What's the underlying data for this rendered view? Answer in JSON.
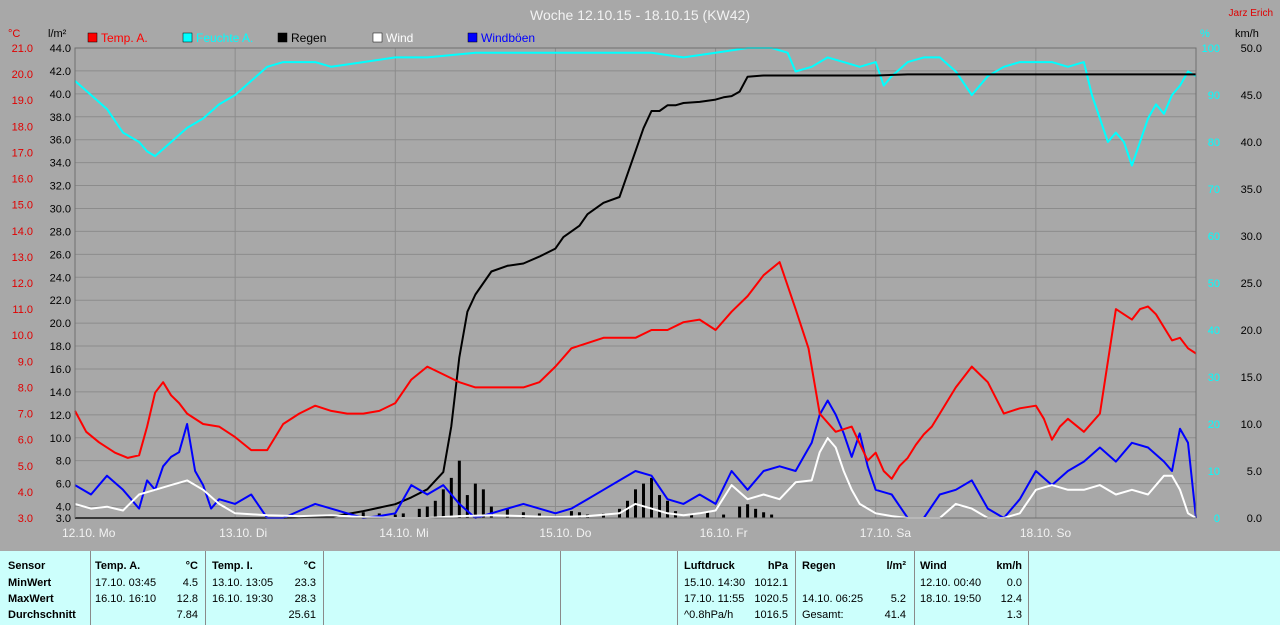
{
  "chart_data": {
    "type": "line",
    "title": "Woche 12.10.15 - 18.10.15 (KW42)",
    "author": "Jarz Erich",
    "x_start": "12.10. 00:00",
    "x_end": "18.10. 23:59",
    "x_tick_labels": [
      "12.10. Mo",
      "13.10. Di",
      "14.10. Mi",
      "15.10. Do",
      "16.10. Fr",
      "17.10. Sa",
      "18.10. So"
    ],
    "axes": {
      "temp": {
        "unit": "°C",
        "min": 3.0,
        "max": 21.0,
        "ticks": [
          "21.0",
          "20.0",
          "19.0",
          "18.0",
          "17.0",
          "16.0",
          "15.0",
          "14.0",
          "13.0",
          "12.0",
          "11.0",
          "10.0",
          "9.0",
          "8.0",
          "7.0",
          "6.0",
          "5.0",
          "4.0",
          "3.0"
        ]
      },
      "rain": {
        "unit": "l/m²",
        "min": 3.0,
        "max": 44.0,
        "ticks": [
          "44.0",
          "42.0",
          "40.0",
          "38.0",
          "36.0",
          "34.0",
          "32.0",
          "30.0",
          "28.0",
          "26.0",
          "24.0",
          "22.0",
          "20.0",
          "18.0",
          "16.0",
          "14.0",
          "12.0",
          "10.0",
          "8.0",
          "6.0",
          "4.0",
          "3.0"
        ]
      },
      "humidity": {
        "unit": "%",
        "min": 0,
        "max": 100,
        "ticks": [
          "100",
          "90",
          "80",
          "70",
          "60",
          "50",
          "40",
          "30",
          "20",
          "10",
          "0"
        ]
      },
      "wind": {
        "unit": "km/h",
        "min": 0.0,
        "max": 50.0,
        "ticks": [
          "50.0",
          "45.0",
          "40.0",
          "35.0",
          "30.0",
          "25.0",
          "20.0",
          "15.0",
          "10.0",
          "5.0",
          "0.0"
        ]
      }
    },
    "legend": [
      {
        "name": "Temp. A.",
        "color": "#ff0000"
      },
      {
        "name": "Feuchte A.",
        "color": "#00ffff"
      },
      {
        "name": "Regen",
        "color": "#000000"
      },
      {
        "name": "Wind",
        "color": "#ffffff"
      },
      {
        "name": "Windböen",
        "color": "#0000ff"
      }
    ],
    "grid": true,
    "series": [
      {
        "name": "Temp. A.",
        "axis": "temp",
        "color": "#ff0000",
        "x": [
          0,
          0.07,
          0.15,
          0.25,
          0.33,
          0.4,
          0.45,
          0.5,
          0.55,
          0.6,
          0.65,
          0.7,
          0.8,
          0.9,
          1.0,
          1.1,
          1.2,
          1.3,
          1.4,
          1.5,
          1.6,
          1.7,
          1.8,
          1.9,
          2.0,
          2.1,
          2.2,
          2.3,
          2.4,
          2.5,
          2.6,
          2.7,
          2.8,
          2.9,
          3.0,
          3.1,
          3.2,
          3.3,
          3.4,
          3.5,
          3.6,
          3.7,
          3.8,
          3.9,
          4.0,
          4.1,
          4.2,
          4.3,
          4.4,
          4.5,
          4.58,
          4.65,
          4.75,
          4.85,
          4.95,
          5.0,
          5.05,
          5.1,
          5.15,
          5.2,
          5.25,
          5.3,
          5.35,
          5.4,
          5.5,
          5.6,
          5.7,
          5.8,
          5.9,
          6.0,
          6.05,
          6.1,
          6.15,
          6.2,
          6.3,
          6.4,
          6.5,
          6.6,
          6.65,
          6.7,
          6.75,
          6.8,
          6.85,
          6.9,
          6.95,
          7.0
        ],
        "y": [
          7.1,
          6.3,
          5.9,
          5.5,
          5.3,
          5.4,
          6.5,
          7.8,
          8.2,
          7.7,
          7.4,
          7.0,
          6.6,
          6.5,
          6.1,
          5.6,
          5.6,
          6.6,
          7.0,
          7.3,
          7.1,
          7.0,
          7.0,
          7.1,
          7.4,
          8.3,
          8.8,
          8.5,
          8.2,
          8.0,
          8.0,
          8.0,
          8.0,
          8.2,
          8.8,
          9.5,
          9.7,
          9.9,
          9.9,
          9.9,
          10.2,
          10.2,
          10.5,
          10.6,
          10.2,
          10.9,
          11.5,
          12.3,
          12.8,
          11.0,
          9.5,
          7.0,
          6.3,
          6.5,
          5.2,
          5.5,
          4.8,
          4.5,
          5.0,
          5.3,
          5.8,
          6.2,
          6.5,
          7.0,
          8.0,
          8.8,
          8.2,
          7.0,
          7.2,
          7.3,
          6.8,
          6.0,
          6.5,
          6.8,
          6.3,
          7.0,
          11.0,
          10.6,
          11.0,
          11.1,
          10.8,
          10.3,
          9.8,
          9.9,
          9.5,
          9.3
        ]
      },
      {
        "name": "Feuchte A.",
        "axis": "humidity",
        "color": "#00ffff",
        "x": [
          0,
          0.1,
          0.2,
          0.3,
          0.4,
          0.45,
          0.5,
          0.6,
          0.7,
          0.8,
          0.9,
          1.0,
          1.1,
          1.2,
          1.3,
          1.4,
          1.5,
          1.6,
          1.8,
          2.0,
          2.2,
          2.5,
          2.8,
          3.0,
          3.3,
          3.6,
          3.8,
          4.0,
          4.2,
          4.35,
          4.45,
          4.5,
          4.6,
          4.7,
          4.8,
          4.9,
          5.0,
          5.05,
          5.1,
          5.2,
          5.3,
          5.4,
          5.5,
          5.6,
          5.7,
          5.8,
          5.9,
          6.0,
          6.1,
          6.2,
          6.3,
          6.35,
          6.4,
          6.45,
          6.5,
          6.55,
          6.6,
          6.65,
          6.7,
          6.75,
          6.8,
          6.85,
          6.9,
          6.95,
          7.0
        ],
        "y": [
          93,
          90,
          87,
          82,
          80,
          78,
          77,
          80,
          83,
          85,
          88,
          90,
          93,
          96,
          97,
          97,
          97,
          96,
          97,
          98,
          98,
          99,
          99,
          99,
          99,
          99,
          98,
          99,
          100,
          100,
          99,
          95,
          96,
          98,
          97,
          96,
          97,
          92,
          94,
          97,
          98,
          98,
          95,
          90,
          94,
          96,
          97,
          97,
          97,
          96,
          97,
          90,
          85,
          80,
          82,
          80,
          75,
          80,
          85,
          88,
          86,
          90,
          92,
          95,
          94
        ]
      },
      {
        "name": "Regen",
        "axis": "rain",
        "color": "#000000",
        "x": [
          0,
          0.5,
          1.0,
          1.3,
          1.6,
          1.8,
          2.0,
          2.1,
          2.2,
          2.3,
          2.35,
          2.4,
          2.45,
          2.5,
          2.55,
          2.6,
          2.7,
          2.8,
          2.9,
          3.0,
          3.05,
          3.1,
          3.15,
          3.2,
          3.3,
          3.4,
          3.45,
          3.5,
          3.55,
          3.6,
          3.65,
          3.7,
          3.75,
          3.8,
          3.9,
          4.0,
          4.05,
          4.1,
          4.15,
          4.2,
          4.3,
          4.4,
          4.5,
          4.6,
          4.8,
          5.0,
          5.2,
          5.4,
          5.6,
          5.8,
          6.0,
          6.2,
          6.4,
          6.6,
          6.8,
          7.0
        ],
        "y": [
          3.0,
          3.0,
          3.0,
          3.0,
          3.1,
          3.6,
          4.2,
          4.8,
          5.5,
          7.0,
          11.0,
          17.0,
          21.0,
          22.5,
          23.5,
          24.5,
          25.0,
          25.2,
          25.8,
          26.5,
          27.5,
          28.0,
          28.5,
          29.5,
          30.5,
          31.0,
          33.0,
          35.0,
          37.0,
          38.5,
          38.5,
          39.0,
          39.0,
          39.2,
          39.3,
          39.5,
          39.7,
          39.8,
          40.2,
          41.5,
          41.6,
          41.6,
          41.6,
          41.6,
          41.6,
          41.6,
          41.7,
          41.7,
          41.7,
          41.7,
          41.7,
          41.7,
          41.7,
          41.7,
          41.7,
          41.7
        ]
      },
      {
        "name": "Wind",
        "axis": "wind",
        "color": "#ffffff",
        "x": [
          0,
          0.1,
          0.2,
          0.3,
          0.4,
          0.5,
          0.6,
          0.7,
          0.8,
          0.9,
          1.0,
          1.2,
          1.4,
          1.6,
          1.8,
          2.0,
          2.2,
          2.4,
          2.6,
          2.8,
          3.0,
          3.2,
          3.4,
          3.5,
          3.6,
          3.7,
          3.8,
          3.9,
          4.0,
          4.1,
          4.2,
          4.3,
          4.4,
          4.5,
          4.6,
          4.65,
          4.7,
          4.75,
          4.8,
          4.85,
          4.9,
          4.95,
          5.0,
          5.1,
          5.2,
          5.3,
          5.4,
          5.5,
          5.6,
          5.7,
          5.8,
          5.9,
          6.0,
          6.1,
          6.2,
          6.3,
          6.4,
          6.5,
          6.6,
          6.7,
          6.8,
          6.85,
          6.9,
          6.95,
          7.0
        ],
        "y": [
          1.5,
          1.0,
          1.2,
          0.8,
          2.5,
          3.0,
          3.5,
          4.0,
          3.0,
          1.5,
          0.5,
          0.3,
          0.2,
          0.3,
          0.1,
          0,
          0,
          0.2,
          0.3,
          0.2,
          0.1,
          0.2,
          0.5,
          1.5,
          1.0,
          0.5,
          0.3,
          0.5,
          0.8,
          3.5,
          2.0,
          2.5,
          2.0,
          3.8,
          4.0,
          7.0,
          8.5,
          7.5,
          5.0,
          3.0,
          1.5,
          1.0,
          0.5,
          0.2,
          0,
          0,
          0,
          1.5,
          1.0,
          0,
          0,
          0.5,
          3.0,
          3.5,
          3.0,
          3.0,
          3.5,
          2.5,
          3.0,
          2.5,
          4.5,
          4.5,
          3.0,
          0.5,
          0
        ]
      },
      {
        "name": "Windböen",
        "axis": "wind",
        "color": "#0000ff",
        "x": [
          0,
          0.1,
          0.2,
          0.3,
          0.4,
          0.45,
          0.5,
          0.55,
          0.6,
          0.65,
          0.7,
          0.75,
          0.8,
          0.85,
          0.9,
          1.0,
          1.1,
          1.2,
          1.3,
          1.5,
          1.7,
          1.8,
          1.9,
          2.0,
          2.1,
          2.2,
          2.3,
          2.4,
          2.5,
          2.6,
          2.8,
          3.0,
          3.1,
          3.2,
          3.3,
          3.4,
          3.5,
          3.6,
          3.7,
          3.8,
          3.9,
          4.0,
          4.1,
          4.2,
          4.3,
          4.4,
          4.5,
          4.55,
          4.6,
          4.65,
          4.7,
          4.75,
          4.8,
          4.85,
          4.9,
          4.95,
          5.0,
          5.1,
          5.2,
          5.3,
          5.4,
          5.5,
          5.6,
          5.7,
          5.8,
          5.9,
          6.0,
          6.1,
          6.2,
          6.3,
          6.4,
          6.5,
          6.6,
          6.7,
          6.8,
          6.85,
          6.9,
          6.95,
          7.0
        ],
        "y": [
          3.5,
          2.5,
          4.5,
          3.0,
          1.0,
          4.0,
          3.0,
          5.5,
          6.5,
          7.0,
          10.0,
          5.0,
          3.5,
          1.0,
          2.0,
          1.5,
          2.5,
          0,
          0,
          1.5,
          0.5,
          0,
          0.2,
          0.5,
          3.5,
          2.5,
          3.5,
          1.5,
          0,
          0.5,
          1.5,
          0.5,
          1.0,
          2.0,
          3.0,
          4.0,
          5.0,
          4.5,
          2.0,
          1.5,
          2.5,
          1.5,
          5.0,
          3.0,
          5.0,
          5.5,
          5.0,
          6.5,
          8.0,
          11.0,
          12.5,
          11.0,
          9.0,
          6.5,
          9.0,
          5.5,
          3.0,
          2.5,
          0,
          0,
          2.5,
          3.0,
          4.0,
          1.0,
          0,
          2.0,
          5.0,
          3.5,
          5.0,
          6.0,
          7.5,
          6.0,
          8.0,
          7.5,
          6.0,
          5.0,
          9.5,
          8.0,
          0
        ]
      }
    ],
    "rain_bars": {
      "name": "Regen (Intervall)",
      "axis": "rain",
      "color": "#000000",
      "x": [
        1.8,
        1.9,
        2.0,
        2.05,
        2.15,
        2.2,
        2.25,
        2.3,
        2.35,
        2.4,
        2.45,
        2.5,
        2.55,
        2.6,
        2.7,
        2.8,
        2.9,
        3.1,
        3.15,
        3.2,
        3.3,
        3.4,
        3.45,
        3.5,
        3.55,
        3.6,
        3.65,
        3.7,
        3.75,
        3.85,
        3.95,
        4.05,
        4.15,
        4.2,
        4.25,
        4.3,
        4.35
      ],
      "y": [
        0.5,
        0.4,
        0.3,
        0.4,
        0.8,
        1.0,
        1.5,
        2.5,
        3.5,
        5.0,
        2.0,
        3.0,
        2.5,
        1.0,
        0.8,
        0.5,
        0.4,
        0.6,
        0.5,
        0.3,
        0.4,
        0.8,
        1.5,
        2.5,
        3.0,
        3.5,
        2.0,
        1.5,
        0.6,
        0.4,
        0.5,
        0.3,
        1.0,
        1.2,
        0.8,
        0.5,
        0.3
      ]
    }
  },
  "table": {
    "columns": [
      {
        "name": "sensor",
        "header": "Sensor",
        "unit": ""
      },
      {
        "name": "temp_a",
        "header": "Temp. A.",
        "unit": "°C"
      },
      {
        "name": "temp_i",
        "header": "Temp. I.",
        "unit": "°C"
      },
      {
        "name": "pressure",
        "header": "Luftdruck",
        "unit": "hPa"
      },
      {
        "name": "rain",
        "header": "Regen",
        "unit": "l/m²"
      },
      {
        "name": "wind",
        "header": "Wind",
        "unit": "km/h"
      }
    ],
    "rows": [
      {
        "sensor": "MinWert",
        "temp_a": [
          "17.10.  03:45",
          "4.5"
        ],
        "temp_i": [
          "13.10.  13:05",
          "23.3"
        ],
        "pressure": [
          "15.10.  14:30",
          "1012.1"
        ],
        "rain": [
          "",
          ""
        ],
        "wind": [
          "12.10.  00:40",
          "0.0"
        ]
      },
      {
        "sensor": "MaxWert",
        "temp_a": [
          "16.10.  16:10",
          "12.8"
        ],
        "temp_i": [
          "16.10.  19:30",
          "28.3"
        ],
        "pressure": [
          "17.10.  11:55",
          "1020.5"
        ],
        "rain": [
          "14.10.  06:25",
          "5.2"
        ],
        "wind": [
          "18.10.  19:50",
          "12.4"
        ]
      },
      {
        "sensor": "Durchschnitt",
        "temp_a": [
          "",
          "7.84"
        ],
        "temp_i": [
          "",
          "25.61"
        ],
        "pressure": [
          "^0.8hPa/h",
          "1016.5"
        ],
        "rain": [
          "Gesamt:",
          "41.4"
        ],
        "wind": [
          "",
          "1.3"
        ]
      }
    ]
  }
}
